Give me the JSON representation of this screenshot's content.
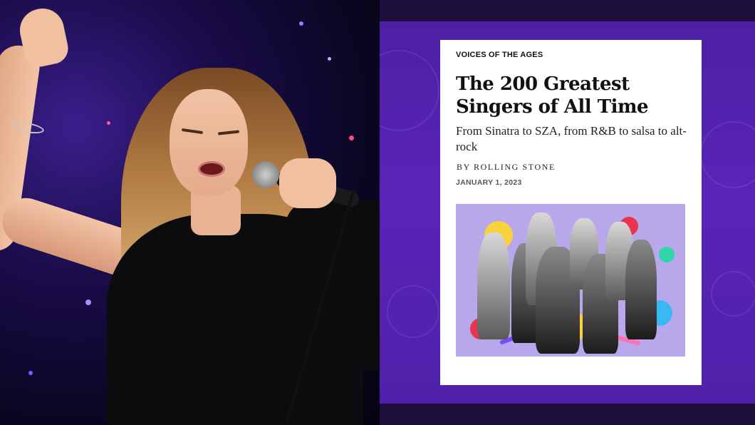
{
  "article": {
    "kicker": "VOICES OF THE AGES",
    "title": "The 200 Greatest Singers of All Time",
    "subtitle": "From Sinatra to SZA, from R&B to salsa to alt-rock",
    "byline": "BY ROLLING STONE",
    "date": "JANUARY 1, 2023"
  },
  "colors": {
    "panel_purple": "#5a24b8",
    "band_dark": "#1c0f3c",
    "hero_lavender": "#b8a7ea",
    "card_white": "#ffffff"
  },
  "images": {
    "left_photo": "singer-performing-photo",
    "hero_illustration": "singers-collage-illustration"
  }
}
